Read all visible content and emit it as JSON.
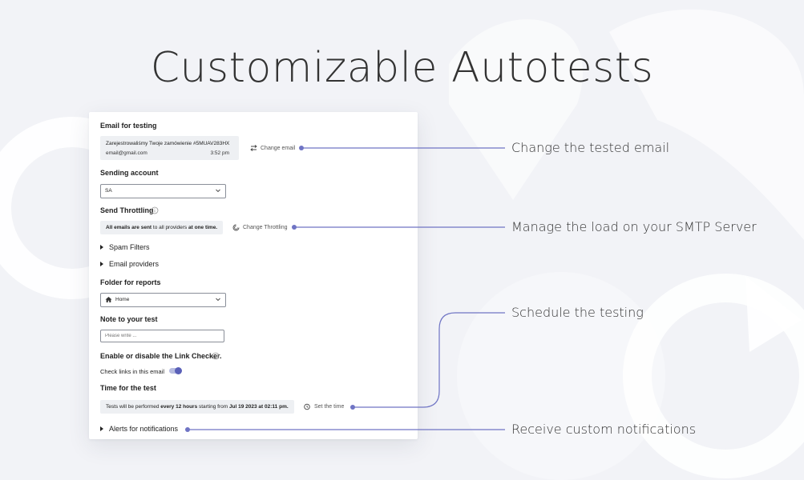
{
  "headline": "Customizable Autotests",
  "form": {
    "email_section_label": "Email for testing",
    "email_subject": "Zarejestrowaliśmy Twoje zamówienie #5MUAV283HX",
    "email_address": "email@gmail.com",
    "email_time": "3:52 pm",
    "change_email_label": "Change email",
    "sending_account_label": "Sending account",
    "sending_account_value": "SA",
    "throttling_label": "Send Throttling",
    "throttling_info_a": "All emails are sent",
    "throttling_info_b": "to all providers",
    "throttling_info_c": "at one time.",
    "change_throttling_label": "Change Throttling",
    "spam_filters_label": "Spam Filters",
    "email_providers_label": "Email providers",
    "folder_label": "Folder for reports",
    "folder_value": "Home",
    "note_label": "Note to your test",
    "note_placeholder": "Please write ...",
    "link_checker_label": "Enable or disable the Link Checker.",
    "check_links_label": "Check links in this email",
    "check_links_enabled": true,
    "time_label": "Time for the test",
    "time_info_a": "Tests will be performed",
    "time_info_b": "every 12 hours",
    "time_info_c": "starting from",
    "time_info_d": "Jul 19 2023 at 02:11 pm.",
    "set_time_label": "Set the time",
    "alerts_label": "Alerts for notifications"
  },
  "callouts": {
    "change_email": "Change the tested email",
    "throttling": "Manage the load on your SMTP Server",
    "schedule": "Schedule the testing",
    "notifications": "Receive custom notifications"
  },
  "colors": {
    "accent": "#5a60b8",
    "background": "#f2f3f7",
    "info_box": "#eef0f3"
  }
}
